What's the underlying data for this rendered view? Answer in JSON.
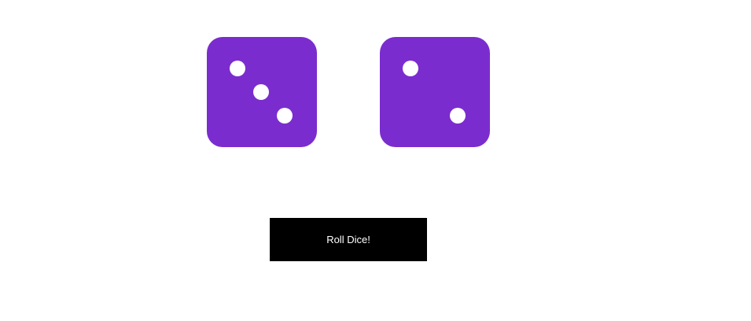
{
  "dice": [
    {
      "value": 3
    },
    {
      "value": 2
    }
  ],
  "button": {
    "label": "Roll Dice!"
  },
  "colors": {
    "die": "#7b2cce",
    "pip": "#ffffff",
    "button_bg": "#000000",
    "button_text": "#ffffff"
  }
}
